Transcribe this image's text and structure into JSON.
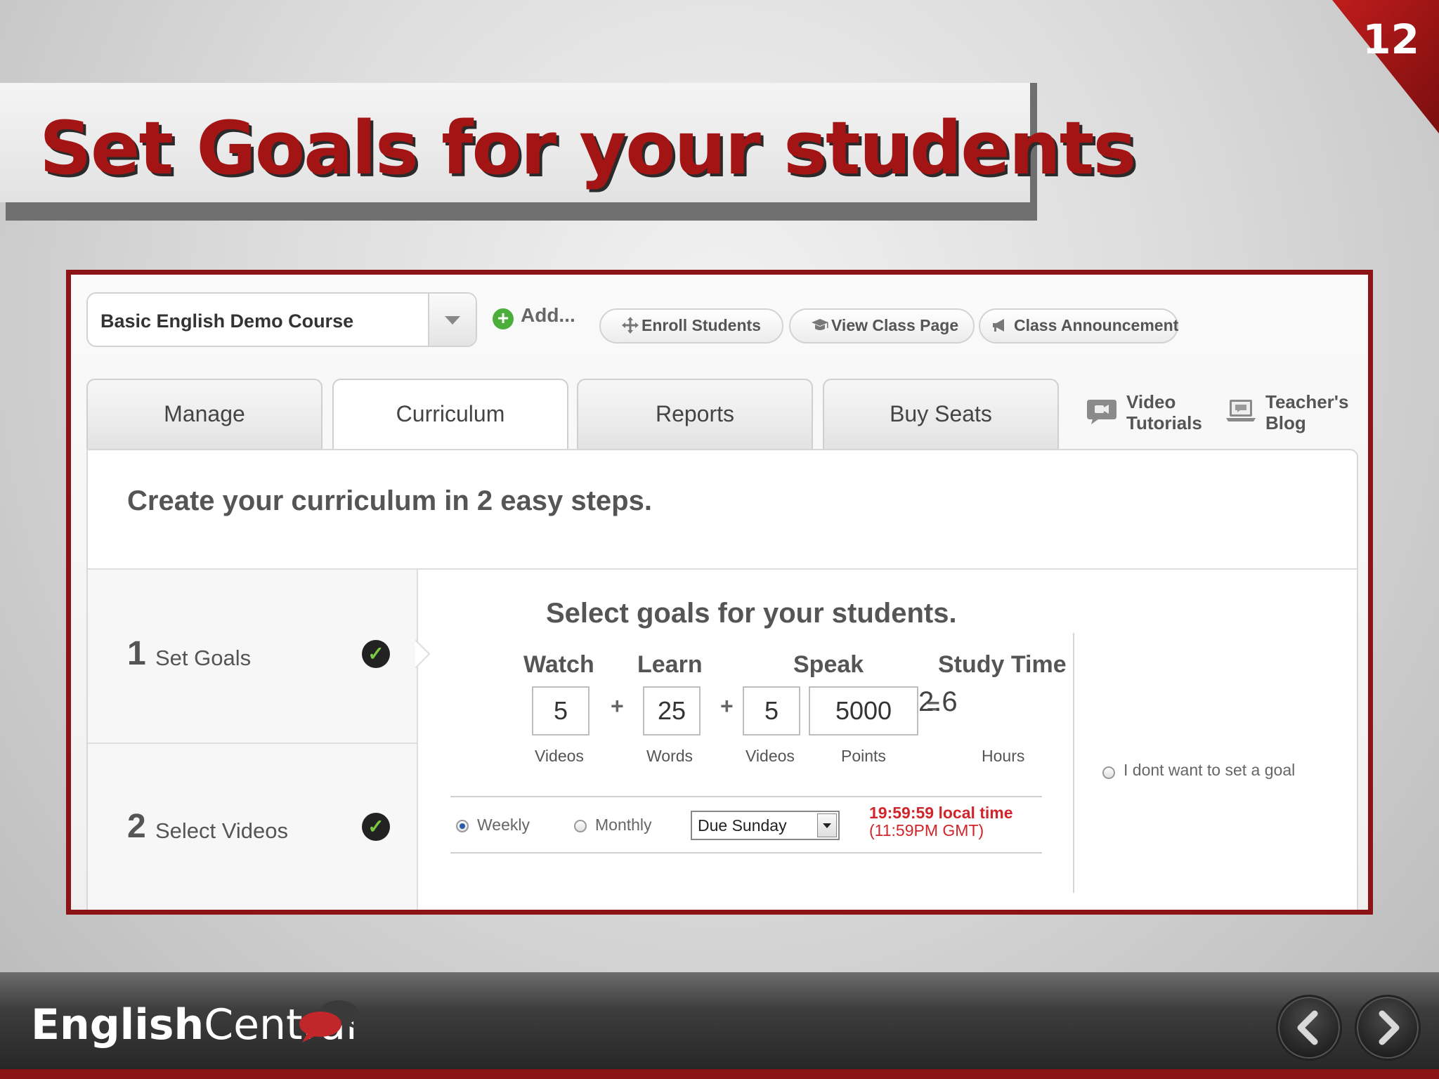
{
  "slide": {
    "page_number": "12",
    "title": "Set Goals for your students"
  },
  "toolbar": {
    "course_name": "Basic English Demo Course",
    "add_label": "Add...",
    "enroll_label": "Enroll Students",
    "view_class_label": "View Class Page",
    "announcement_label": "Class Announcement"
  },
  "tabs": [
    {
      "label": "Manage"
    },
    {
      "label": "Curriculum"
    },
    {
      "label": "Reports"
    },
    {
      "label": "Buy Seats"
    }
  ],
  "links": {
    "video_tutorials": [
      "Video",
      "Tutorials"
    ],
    "teachers_blog": [
      "Teacher's",
      "Blog"
    ]
  },
  "curriculum": {
    "heading": "Create your curriculum in 2 easy steps.",
    "steps": [
      {
        "number": "1",
        "label": "Set Goals"
      },
      {
        "number": "2",
        "label": "Select Videos"
      }
    ]
  },
  "goals": {
    "title": "Select goals for your students.",
    "watch": {
      "header": "Watch",
      "value": "5",
      "unit": "Videos"
    },
    "learn": {
      "header": "Learn",
      "value": "25",
      "unit": "Words"
    },
    "speak": {
      "header": "Speak",
      "videos_value": "5",
      "videos_unit": "Videos",
      "points_value": "5000",
      "points_unit": "Points"
    },
    "study_time": {
      "header": "Study Time",
      "value": "2.6",
      "unit": "Hours"
    },
    "plus": "+",
    "equals": "=",
    "weekly_label": "Weekly",
    "monthly_label": "Monthly",
    "due_value": "Due Sunday",
    "deadline_local": "19:59:59 local time",
    "deadline_gmt": "(11:59PM GMT)",
    "no_goal_label": "I dont want to set a goal"
  },
  "footer": {
    "brand_bold": "English",
    "brand_light": "Central"
  },
  "colors": {
    "title_red": "#a31515",
    "frame_red": "#8d1416",
    "deadline_red": "#d0252a",
    "check_green": "#7ac943"
  }
}
